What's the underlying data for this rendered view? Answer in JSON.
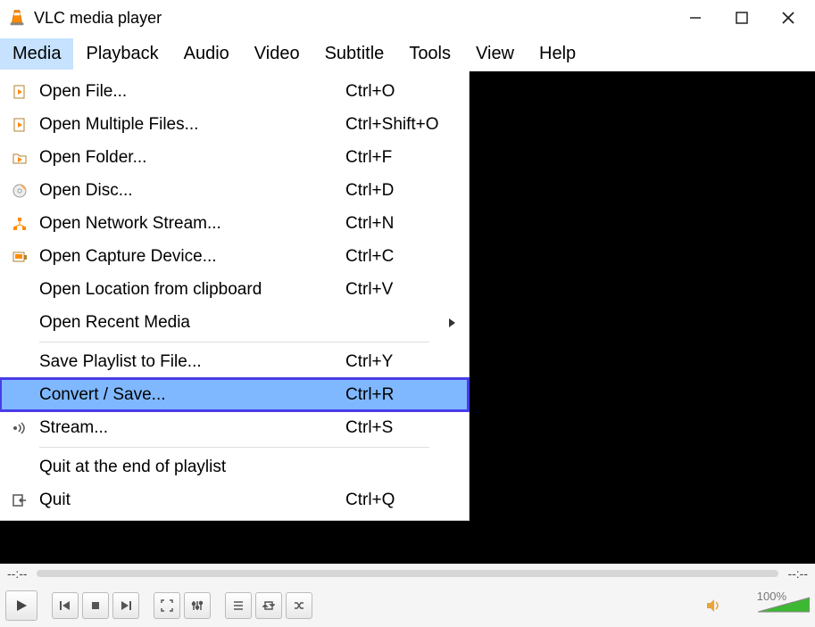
{
  "window": {
    "title": "VLC media player"
  },
  "menubar": {
    "items": [
      {
        "label": "Media",
        "active": true
      },
      {
        "label": "Playback"
      },
      {
        "label": "Audio"
      },
      {
        "label": "Video"
      },
      {
        "label": "Subtitle"
      },
      {
        "label": "Tools"
      },
      {
        "label": "View"
      },
      {
        "label": "Help"
      }
    ]
  },
  "media_menu": [
    {
      "icon": "file-play",
      "label": "Open File...",
      "shortcut": "Ctrl+O"
    },
    {
      "icon": "file-play",
      "label": "Open Multiple Files...",
      "shortcut": "Ctrl+Shift+O"
    },
    {
      "icon": "folder-play",
      "label": "Open Folder...",
      "shortcut": "Ctrl+F"
    },
    {
      "icon": "disc",
      "label": "Open Disc...",
      "shortcut": "Ctrl+D"
    },
    {
      "icon": "network",
      "label": "Open Network Stream...",
      "shortcut": "Ctrl+N"
    },
    {
      "icon": "capture",
      "label": "Open Capture Device...",
      "shortcut": "Ctrl+C"
    },
    {
      "icon": "",
      "label": "Open Location from clipboard",
      "shortcut": "Ctrl+V"
    },
    {
      "icon": "",
      "label": "Open Recent Media",
      "shortcut": "",
      "submenu": true
    },
    {
      "separator": true
    },
    {
      "icon": "",
      "label": "Save Playlist to File...",
      "shortcut": "Ctrl+Y"
    },
    {
      "icon": "",
      "label": "Convert / Save...",
      "shortcut": "Ctrl+R",
      "highlighted": true
    },
    {
      "icon": "stream",
      "label": "Stream...",
      "shortcut": "Ctrl+S"
    },
    {
      "separator": true
    },
    {
      "icon": "",
      "label": "Quit at the end of playlist",
      "shortcut": ""
    },
    {
      "icon": "quit",
      "label": "Quit",
      "shortcut": "Ctrl+Q"
    }
  ],
  "time": {
    "left": "--:--",
    "right": "--:--"
  },
  "volume": {
    "percent": "100%"
  }
}
